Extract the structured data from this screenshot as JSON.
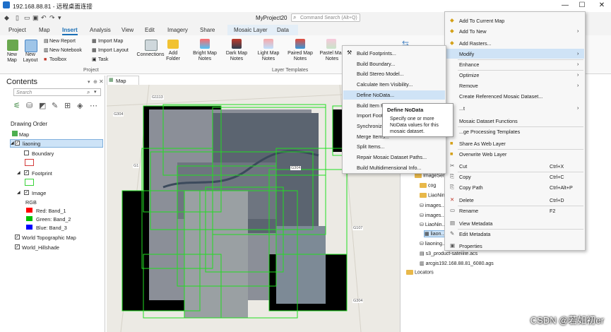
{
  "window": {
    "title": "192.168.88.81 - 远程桌面连接",
    "min_icon": "—",
    "max_icon": "☐",
    "close_icon": "✕"
  },
  "app": {
    "project_name": "MyProject20",
    "command_search_placeholder": "Command Search (Alt+Q)"
  },
  "tabs": [
    "Project",
    "Map",
    "Insert",
    "Analysis",
    "View",
    "Edit",
    "Imagery",
    "Share",
    "Mosaic Layer",
    "Data"
  ],
  "active_tab": "Insert",
  "ribbon": {
    "new_map": "New Map",
    "new_layout": "New Layout",
    "new_report": "New Report",
    "new_notebook": "New Notebook",
    "toolbox": "Toolbox",
    "import_map": "Import Map",
    "import_layout": "Import Layout",
    "task": "Task",
    "connections": "Connections",
    "add_folder": "Add Folder",
    "bright_notes": "Bright Map Notes",
    "dark_notes": "Dark Map Notes",
    "light_notes": "Light Map Notes",
    "paired_notes": "Paired Map Notes",
    "pastel_notes": "Pastel Map Notes",
    "group_project": "Project",
    "group_layer_templates": "Layer Templates"
  },
  "contents": {
    "title": "Contents",
    "search_placeholder": "Search",
    "drawing_order": "Drawing Order",
    "items": {
      "map": "Map",
      "layer": "liaoning",
      "boundary": "Boundary",
      "footprint": "Footprint",
      "image": "Image",
      "rgb": "RGB",
      "red": "Red:  Band_1",
      "green": "Green: Band_2",
      "blue": "Blue:  Band_3",
      "topo": "World Topographic Map",
      "hillshade": "World_Hillshade"
    },
    "colors": {
      "red": "#ff0000",
      "green": "#00c000",
      "blue": "#0000ff",
      "footprint": "#39d339",
      "boundary": "#d43c3c"
    }
  },
  "map_tab": "Map",
  "map_labels": [
    "G1113",
    "G304",
    "G1",
    "G304",
    "G107",
    "G304"
  ],
  "submenu": {
    "items": [
      "Build Footprints...",
      "Build Boundary...",
      "Build Stereo Model...",
      "Calculate Item Visibility...",
      "Define NoData...",
      "Build Item P...",
      "Import Footp...",
      "Synchronize...",
      "Merge Items...",
      "Split Items...",
      "Repair Mosaic Dataset Paths...",
      "Build Multidimensional Info..."
    ],
    "highlighted_index": 4
  },
  "tooltip": {
    "title": "Define NoData",
    "body": "Specify one or more NoData values for this mosaic dataset."
  },
  "context_menu": {
    "items": [
      {
        "label": "Add To Current Map",
        "key": "",
        "arrow": false
      },
      {
        "label": "Add To New",
        "key": "",
        "arrow": true
      },
      {
        "label": "Add Rasters...",
        "key": "",
        "arrow": false
      },
      {
        "label": "Modify",
        "key": "",
        "arrow": true
      },
      {
        "label": "Enhance",
        "key": "",
        "arrow": true
      },
      {
        "label": "Optimize",
        "key": "",
        "arrow": true
      },
      {
        "label": "Remove",
        "key": "",
        "arrow": true
      },
      {
        "label": "Create Referenced Mosaic Dataset...",
        "key": "",
        "arrow": false
      },
      {
        "label": "...t",
        "key": "",
        "arrow": true
      },
      {
        "label": "Mosaic Dataset Functions",
        "key": "",
        "arrow": false
      },
      {
        "label": "...ge Processing Templates",
        "key": "",
        "arrow": false
      },
      {
        "label": "Share As Web Layer",
        "key": "",
        "arrow": false
      },
      {
        "label": "Overwrite Web Layer",
        "key": "",
        "arrow": false
      },
      {
        "label": "Cut",
        "key": "Ctrl+X",
        "arrow": false
      },
      {
        "label": "Copy",
        "key": "Ctrl+C",
        "arrow": false
      },
      {
        "label": "Copy Path",
        "key": "Ctrl+Alt+P",
        "arrow": false
      },
      {
        "label": "Delete",
        "key": "Ctrl+D",
        "arrow": false
      },
      {
        "label": "Rename",
        "key": "F2",
        "arrow": false
      },
      {
        "label": "View Metadata",
        "key": "",
        "arrow": false
      },
      {
        "label": "Edit Metadata",
        "key": "",
        "arrow": false
      },
      {
        "label": "Properties",
        "key": "",
        "arrow": false
      }
    ],
    "highlighted_index": 3
  },
  "catalog": {
    "rows": [
      "ImageServ...",
      "cog",
      "LiaoNin...",
      "images...",
      "images...",
      "LiaoNin...",
      "liaon...",
      "liaoning...",
      "s3_product-satellite.acs",
      "arcgis192.168.88.81_6080.ags",
      "Locators"
    ]
  },
  "watermark": "CSDN @若如初er"
}
